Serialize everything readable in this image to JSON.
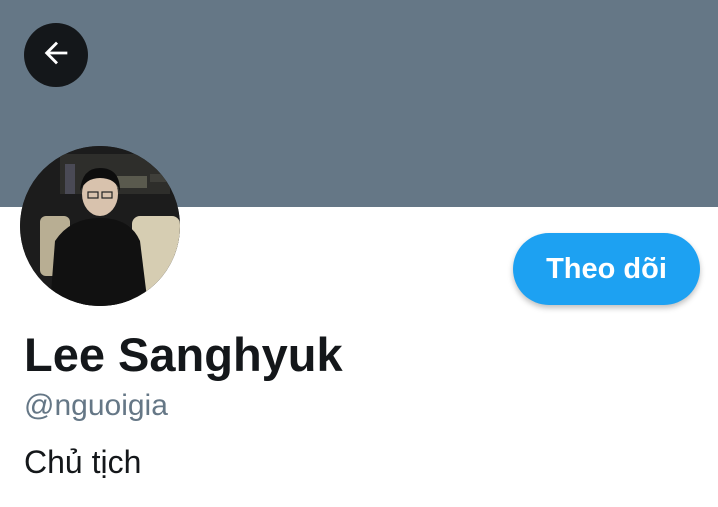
{
  "header": {
    "back_icon": "arrow-left-icon",
    "banner_color": "#657786"
  },
  "profile": {
    "display_name": "Lee Sanghyuk",
    "handle": "@nguoigia",
    "bio": "Chủ tịch",
    "follow_label": "Theo dõi",
    "accent_color": "#1da1f2"
  }
}
